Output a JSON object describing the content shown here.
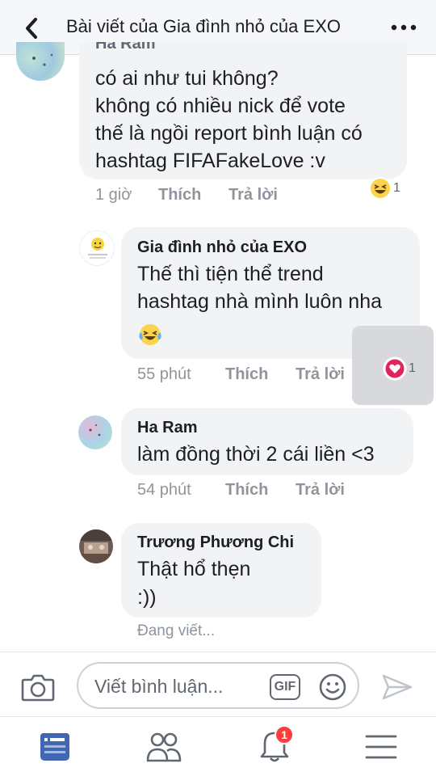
{
  "header": {
    "title": "Bài viết của Gia đình nhỏ của EXO"
  },
  "comments": [
    {
      "author": "Ha Ram",
      "lines": [
        "có ai như tui không?",
        "không có nhiều nick để vote",
        "thế là ngồi report bình luận có",
        "hashtag FIFAFakeLove :v"
      ],
      "time": "1 giờ",
      "like": "Thích",
      "reply": "Trả lời",
      "reaction_count": "1",
      "reaction_icon": "haha-icon"
    },
    {
      "author": "Gia đình nhỏ của EXO",
      "lines": [
        "Thế thì tiện thể trend",
        "hashtag nhà mình luôn nha"
      ],
      "emoji": "😂",
      "time": "55 phút",
      "like": "Thích",
      "reply": "Trả lời",
      "reaction_count": "1",
      "reaction_icon": "love-icon"
    },
    {
      "author": "Ha Ram",
      "lines": [
        "làm đồng thời 2 cái liền <3"
      ],
      "time": "54 phút",
      "like": "Thích",
      "reply": "Trả lời"
    },
    {
      "author": "Trương Phương Chi",
      "lines": [
        "Thật hổ thẹn",
        ":))"
      ]
    }
  ],
  "typing_indicator": "Đang viết...",
  "composer": {
    "placeholder": "Viết bình luận...",
    "gif_label": "GIF"
  },
  "nav": {
    "notification_count": "1"
  },
  "colors": {
    "bubble": "#f2f3f5",
    "meta_text": "#90949c",
    "accent_blue": "#4267b2",
    "badge_red": "#fa3e3e",
    "love_red": "#e0245e"
  }
}
